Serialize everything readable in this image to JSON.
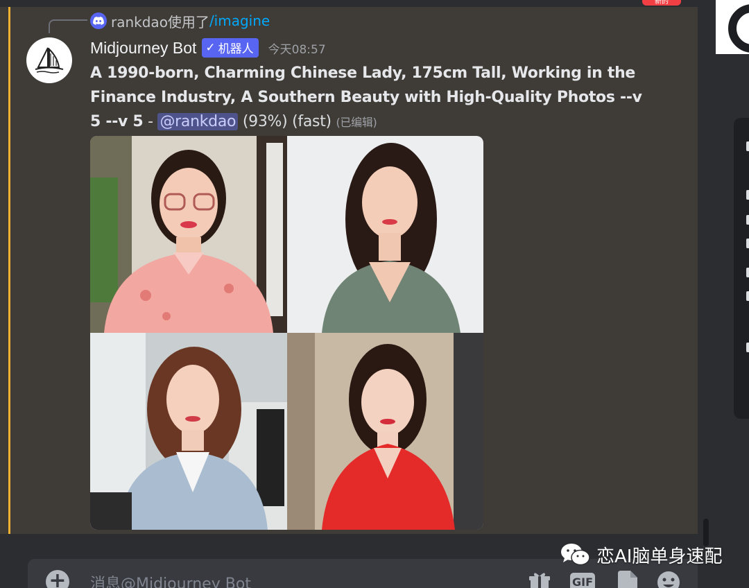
{
  "badge": {
    "new_label": "新的"
  },
  "reply": {
    "user": "rankdao使用了",
    "command": "/imagine"
  },
  "author": {
    "name": "Midjourney Bot",
    "bot_tag": "机器人",
    "timestamp": "今天08:57"
  },
  "message": {
    "prompt": "A 1990-born, Charming Chinese Lady, 175cm Tall, Working in the Finance Industry, A Southern Beauty with High-Quality Photos --v 5 --v 5",
    "separator": " - ",
    "mention": "@rankdao",
    "status": " (93%) (fast) ",
    "edited": "(已编辑)"
  },
  "image_grid": {
    "images": [
      {
        "description": "woman with glasses in pink blouse"
      },
      {
        "description": "woman in green cardigan"
      },
      {
        "description": "woman in blue blazer"
      },
      {
        "description": "woman in red silk dress"
      }
    ]
  },
  "composer": {
    "placeholder": "消息@Midjourney Bot"
  },
  "toolbar": {
    "gif_label": "GIF"
  },
  "watermark": {
    "text": "恋AI脑单身速配"
  },
  "colors": {
    "mention_bg": "#4f538b",
    "highlight": "#f0b232",
    "blurple": "#5865f2",
    "link": "#00a8fc"
  }
}
